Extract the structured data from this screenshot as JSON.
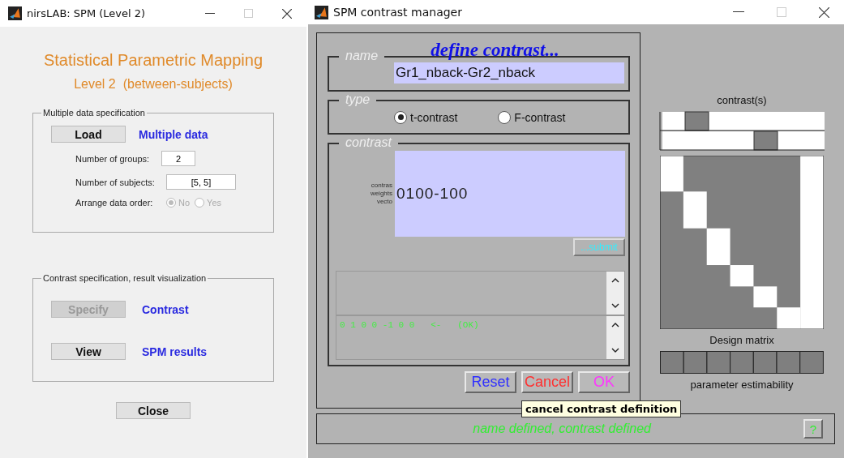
{
  "left_window": {
    "title": "nirsLAB: SPM (Level 2)",
    "heading": "Statistical Parametric Mapping",
    "subheading": "Level 2  (between-subjects)",
    "data_group": {
      "legend": "Multiple data specification",
      "load_button": "Load",
      "load_label": "Multiple data",
      "fields": [
        {
          "label": "Number of groups:",
          "value": "2"
        },
        {
          "label": "Number of subjects:",
          "value": "[5, 5]"
        }
      ],
      "order": {
        "label": "Arrange data order:",
        "disabled": true,
        "options": [
          {
            "label": "No",
            "selected": true
          },
          {
            "label": "Yes",
            "selected": false
          }
        ]
      }
    },
    "contrast_group": {
      "legend": "Contrast specification, result visualization",
      "rows": [
        {
          "button": "Specify",
          "disabled": true,
          "label": "Contrast"
        },
        {
          "button": "View",
          "disabled": false,
          "label": "SPM results"
        }
      ]
    },
    "close_button": "Close"
  },
  "right_window": {
    "title": "SPM contrast manager",
    "heading": "define contrast...",
    "name": {
      "legend": "name",
      "value": "Gr1_nback-Gr2_nback"
    },
    "type": {
      "legend": "type",
      "options": [
        {
          "label": "t-contrast",
          "selected": true
        },
        {
          "label": "F-contrast",
          "selected": false
        }
      ]
    },
    "contrast": {
      "legend": "contrast",
      "weights_label": [
        "contras",
        "weights",
        "vecto"
      ],
      "value": "0100-100",
      "submit": "...submit",
      "log": "0 1 0 0 -1 0 0   <-   (OK)"
    },
    "buttons": [
      {
        "label": "Reset",
        "color": "#2f2fff"
      },
      {
        "label": "Cancel",
        "color": "#ff3030"
      },
      {
        "label": "OK",
        "color": "#ff33ff"
      }
    ],
    "tooltip": "cancel contrast definition",
    "status": "name defined, contrast defined",
    "help_button": "?",
    "contrast_plot_title": "contrast(s)",
    "design_matrix_label": "Design matrix",
    "estimability_label": "parameter estimability"
  }
}
